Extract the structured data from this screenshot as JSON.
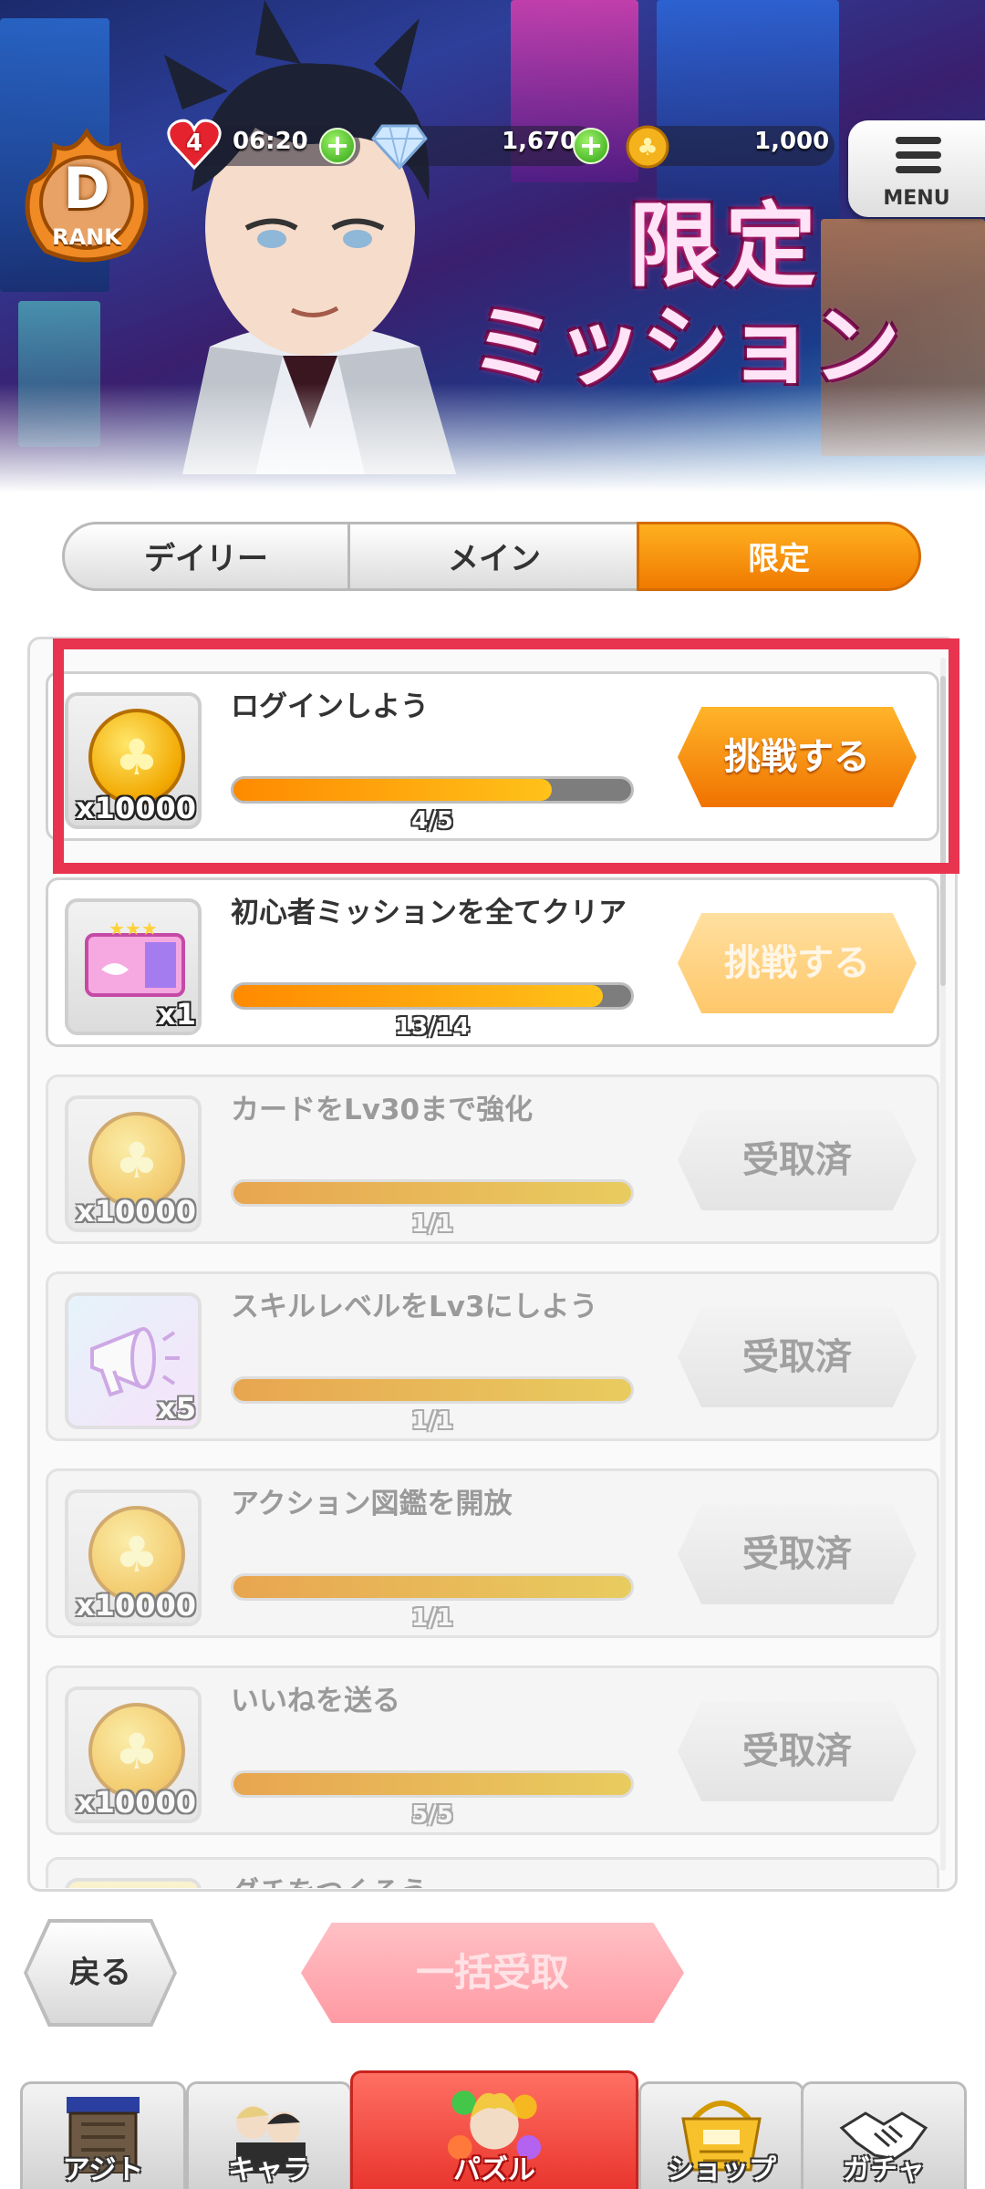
{
  "header": {
    "rank": {
      "letter": "D",
      "word": "RANK"
    },
    "stamina": {
      "count": "4",
      "timer": "06:20"
    },
    "gems": "1,670",
    "coins": "1,000",
    "menu_label": "MENU",
    "banner_line1": "限定",
    "banner_line2": "ミッション"
  },
  "tabs": [
    {
      "label": "デイリー",
      "active": false
    },
    {
      "label": "メイン",
      "active": false
    },
    {
      "label": "限定",
      "active": true
    }
  ],
  "missions": [
    {
      "title": "ログインしよう",
      "reward_icon": "clover-coin-icon",
      "reward_qty": "x10000",
      "progress_text": "4/5",
      "progress": 0.8,
      "button": "挑戦する",
      "state": "challenge"
    },
    {
      "title": "初心者ミッションを全てクリア",
      "reward_icon": "ticket-icon",
      "reward_qty": "x1",
      "progress_text": "13/14",
      "progress": 0.93,
      "button": "挑戦する",
      "state": "challenge-dim"
    },
    {
      "title": "カードをLv30まで強化",
      "reward_icon": "clover-coin-icon",
      "reward_qty": "x10000",
      "progress_text": "1/1",
      "progress": 1.0,
      "button": "受取済",
      "state": "claimed"
    },
    {
      "title": "スキルレベルをLv3にしよう",
      "reward_icon": "megaphone-icon",
      "reward_qty": "x5",
      "progress_text": "1/1",
      "progress": 1.0,
      "button": "受取済",
      "state": "claimed"
    },
    {
      "title": "アクション図鑑を開放",
      "reward_icon": "clover-coin-icon",
      "reward_qty": "x10000",
      "progress_text": "1/1",
      "progress": 1.0,
      "button": "受取済",
      "state": "claimed"
    },
    {
      "title": "いいねを送る",
      "reward_icon": "clover-coin-icon",
      "reward_qty": "x10000",
      "progress_text": "5/5",
      "progress": 1.0,
      "button": "受取済",
      "state": "claimed"
    },
    {
      "title": "ダチをつくろう",
      "reward_icon": "clover-coin-icon",
      "state": "partial"
    }
  ],
  "footer": {
    "back_label": "戻る",
    "bulk_label": "一括受取"
  },
  "nav": [
    {
      "label": "アジト",
      "icon": "hideout-icon"
    },
    {
      "label": "キャラ",
      "icon": "characters-icon"
    },
    {
      "label": "パズル",
      "icon": "puzzle-icon",
      "active": true
    },
    {
      "label": "ショップ",
      "icon": "shop-basket-icon"
    },
    {
      "label": "ガチャ",
      "icon": "handshake-icon"
    }
  ],
  "colors": {
    "accent_orange": "#f07a00",
    "highlight_red": "#e8344f",
    "nav_active": "#e9362e"
  }
}
